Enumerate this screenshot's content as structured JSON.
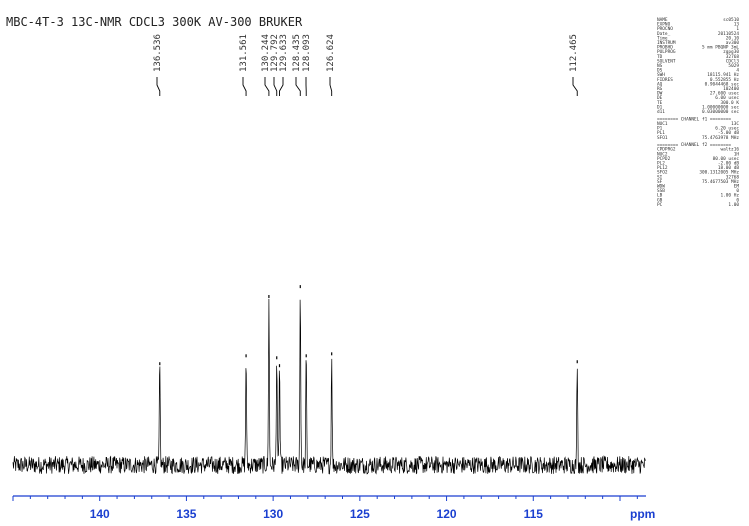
{
  "chart_data": {
    "type": "line",
    "title": "MBC-4T-3 13C-NMR CDCL3 300K AV-300 BRUKER",
    "xlabel": "ppm",
    "xlim": [
      145.0,
      108.5
    ],
    "ylim": [
      -0.08,
      1.0
    ],
    "x_ticks": [
      {
        "value": 140,
        "label": "140"
      },
      {
        "value": 135,
        "label": "135"
      },
      {
        "value": 130,
        "label": "130"
      },
      {
        "value": 125,
        "label": "125"
      },
      {
        "value": 120,
        "label": "120"
      },
      {
        "value": 115,
        "label": "115"
      }
    ],
    "peaks": [
      {
        "ppm": 136.536,
        "label": "136.536",
        "intensity": 0.52
      },
      {
        "ppm": 131.561,
        "label": "131.561",
        "intensity": 0.56
      },
      {
        "ppm": 130.244,
        "label": "130.244",
        "intensity": 0.86
      },
      {
        "ppm": 129.792,
        "label": "129.792",
        "intensity": 0.55
      },
      {
        "ppm": 129.633,
        "label": "129.633",
        "intensity": 0.51
      },
      {
        "ppm": 128.435,
        "label": "128.435",
        "intensity": 0.91
      },
      {
        "ppm": 128.093,
        "label": "128.093",
        "intensity": 0.56
      },
      {
        "ppm": 126.624,
        "label": "126.624",
        "intensity": 0.57
      },
      {
        "ppm": 112.465,
        "label": "112.465",
        "intensity": 0.53
      }
    ],
    "noise_amplitude": 0.045,
    "colors": {
      "spectrum": "#000000",
      "axis": "#1a3fd0",
      "labels": "#333333"
    },
    "grid": false
  },
  "acquisition_params": {
    "block1": [
      [
        "NAME",
        "sc0510"
      ],
      [
        "EXPNO",
        "13"
      ],
      [
        "PROCNO",
        "1"
      ],
      [
        "Date_",
        "20110524"
      ],
      [
        "Time",
        "20.10"
      ],
      [
        "INSTRUM",
        "av300"
      ],
      [
        "PROBHD",
        "5 mm PBQNP 3mL"
      ],
      [
        "PULPROG",
        "zgpg30"
      ],
      [
        "TD",
        "32768"
      ],
      [
        "SOLVENT",
        "CDCl3"
      ],
      [
        "NS",
        "5029"
      ],
      [
        "DS",
        "4"
      ],
      [
        "SWH",
        "18115.941 Hz"
      ],
      [
        "FIDRES",
        "0.552855 Hz"
      ],
      [
        "AQ",
        "0.9044468 sec"
      ],
      [
        "RG",
        "102400"
      ],
      [
        "DW",
        "27.600 usec"
      ],
      [
        "DE",
        "6.00 usec"
      ],
      [
        "TE",
        "300.0 K"
      ],
      [
        "D1",
        "1.00000000 sec"
      ],
      [
        "d11",
        "0.03000000 sec"
      ]
    ],
    "channel_f1_title": "======== CHANNEL f1 ========",
    "channel_f1": [
      [
        "NUC1",
        "13C"
      ],
      [
        "P1",
        "6.20 usec"
      ],
      [
        "PL1",
        "-5.00 dB"
      ],
      [
        "SFO1",
        "75.4763978 MHz"
      ]
    ],
    "channel_f2_title": "======== CHANNEL f2 ========",
    "channel_f2": [
      [
        "CPDPRG2",
        "waltz16"
      ],
      [
        "NUC2",
        "1H"
      ],
      [
        "PCPD2",
        "80.00 usec"
      ],
      [
        "PL2",
        "-2.00 dB"
      ],
      [
        "PL12",
        "18.00 dB"
      ],
      [
        "SFO2",
        "300.1312005 MHz"
      ],
      [
        "SI",
        "32768"
      ],
      [
        "SF",
        "75.4677503 MHz"
      ],
      [
        "WDW",
        "EM"
      ],
      [
        "SSB",
        "0"
      ],
      [
        "LB",
        "1.00 Hz"
      ],
      [
        "GB",
        "0"
      ],
      [
        "PC",
        "1.00"
      ]
    ]
  }
}
